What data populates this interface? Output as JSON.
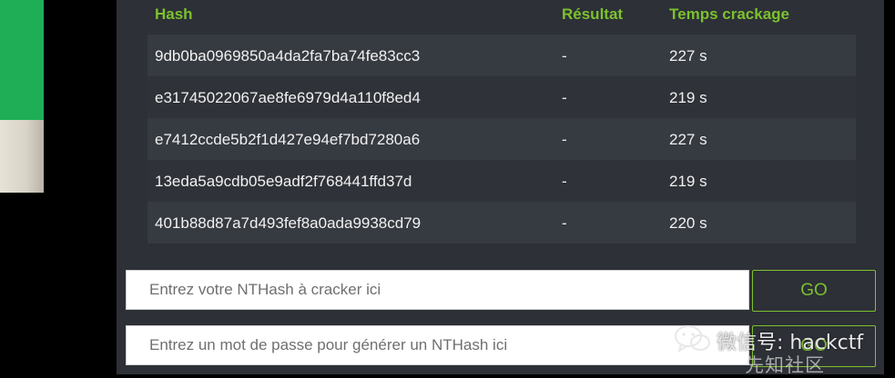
{
  "table": {
    "headers": {
      "hash": "Hash",
      "result": "Résultat",
      "time": "Temps crackage"
    },
    "rows": [
      {
        "hash": "9db0ba0969850a4da2fa7ba74fe83cc3",
        "result": "-",
        "time": "227 s"
      },
      {
        "hash": "e31745022067ae8fe6979d4a110f8ed4",
        "result": "-",
        "time": "219 s"
      },
      {
        "hash": "e7412ccde5b2f1d427e94ef7bd7280a6",
        "result": "-",
        "time": "227 s"
      },
      {
        "hash": "13eda5a9cdb05e9adf2f768441ffd37d",
        "result": "-",
        "time": "219 s"
      },
      {
        "hash": "401b88d87a7d493fef8a0ada9938cd79",
        "result": "-",
        "time": "220 s"
      }
    ]
  },
  "forms": {
    "crack": {
      "placeholder": "Entrez votre NTHash à cracker ici",
      "value": "",
      "button": "GO"
    },
    "generate": {
      "placeholder": "Entrez un mot de passe pour générer un NTHash ici",
      "value": "",
      "button": "GO"
    }
  },
  "watermark": {
    "text": "微信号: hackctf",
    "logo_text": "先知社区",
    "icon": "wechat-icon"
  },
  "colors": {
    "accent": "#7cc12f",
    "panel": "#2d3036",
    "row_odd": "#363a41",
    "row_even": "#2f3238"
  }
}
